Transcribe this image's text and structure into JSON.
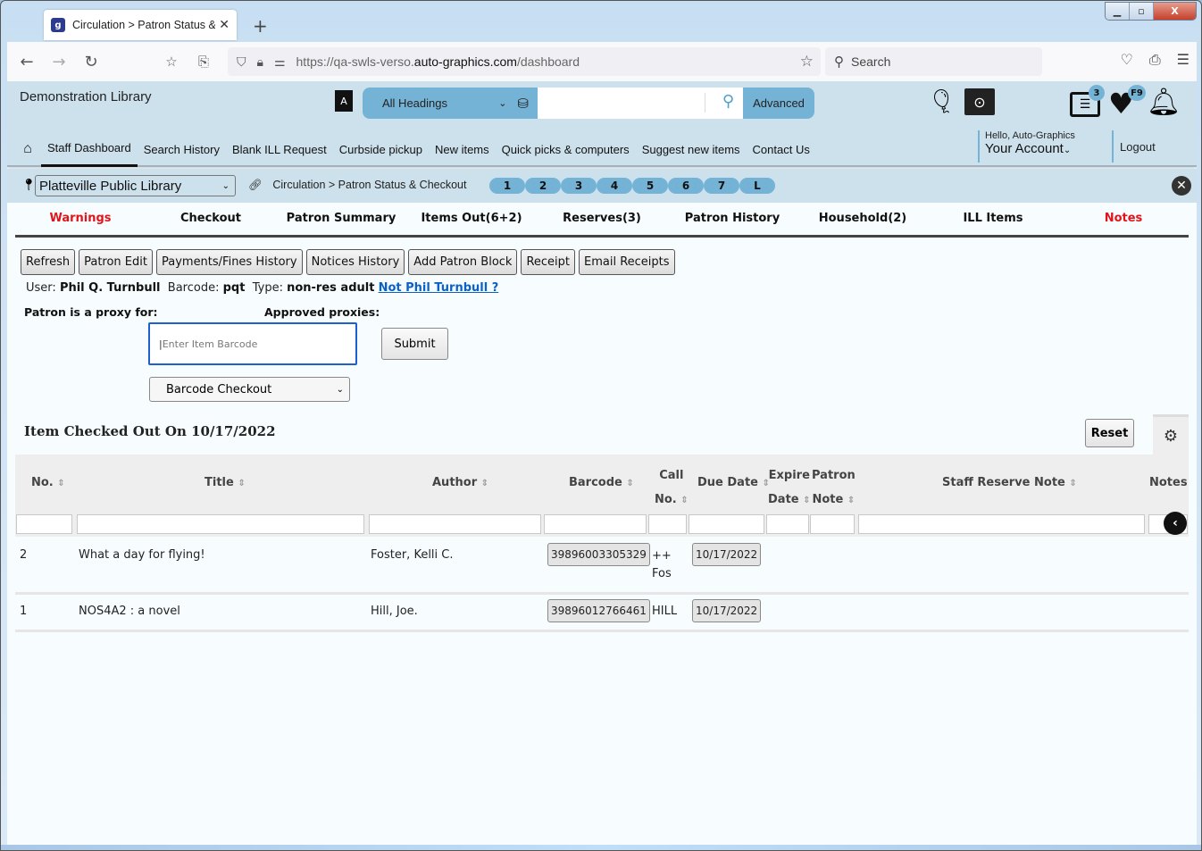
{
  "browser": {
    "tab_title": "Circulation > Patron Status & C",
    "tab_favicon": "g",
    "url_prefix": "https://qa-swls-verso.",
    "url_domain": "auto-graphics.com",
    "url_path": "/dashboard",
    "search_placeholder": "Search",
    "window_controls": {
      "minimize": "—",
      "maximize": "▫",
      "close": "X"
    }
  },
  "header": {
    "library_name": "Demonstration Library",
    "search_scope": "All Headings",
    "search_value": "",
    "advanced_label": "Advanced",
    "cart_badge": "3",
    "favorites_badge": "F9",
    "greeting": "Hello, Auto-Graphics",
    "account_label": "Your Account",
    "logout_label": "Logout"
  },
  "menu": {
    "items": [
      {
        "label": "Staff Dashboard",
        "active": true
      },
      {
        "label": "Search History"
      },
      {
        "label": "Blank ILL Request"
      },
      {
        "label": "Curbside pickup"
      },
      {
        "label": "New items"
      },
      {
        "label": "Quick picks & computers"
      },
      {
        "label": "Suggest new items"
      },
      {
        "label": "Contact Us"
      }
    ]
  },
  "location": {
    "library": "Platteville Public Library",
    "breadcrumb": "Circulation > Patron Status & Checkout",
    "quick_pills": [
      "1",
      "2",
      "3",
      "4",
      "5",
      "6",
      "7",
      "L"
    ]
  },
  "patron_tabs": [
    {
      "label": "Warnings",
      "color": "#e0141a"
    },
    {
      "label": "Checkout"
    },
    {
      "label": "Patron Summary"
    },
    {
      "label": "Items Out(6+2)"
    },
    {
      "label": "Reserves(3)"
    },
    {
      "label": "Patron History"
    },
    {
      "label": "Household(2)"
    },
    {
      "label": "ILL Items"
    },
    {
      "label": "Notes",
      "color": "#e0141a"
    }
  ],
  "actions": [
    "Refresh",
    "Patron Edit",
    "Payments/Fines History",
    "Notices History",
    "Add Patron Block",
    "Receipt",
    "Email Receipts"
  ],
  "patron": {
    "user_label": "User:",
    "user_name": "Phil Q. Turnbull",
    "barcode_label": "Barcode:",
    "barcode": "pqt",
    "type_label": "Type:",
    "type": "non-res adult",
    "not_link": "Not Phil Turnbull ?",
    "proxy_for_label": "Patron is a proxy for:",
    "approved_proxies_label": "Approved proxies:"
  },
  "checkout": {
    "barcode_placeholder": "Enter Item Barcode",
    "submit_label": "Submit",
    "mode": "Barcode Checkout"
  },
  "table": {
    "title": "Item Checked Out On 10/17/2022",
    "reset_label": "Reset",
    "columns": [
      {
        "l1": "",
        "l2": "No."
      },
      {
        "l1": "",
        "l2": "Title"
      },
      {
        "l1": "",
        "l2": "Author"
      },
      {
        "l1": "",
        "l2": "Barcode"
      },
      {
        "l1": "Call",
        "l2": "No."
      },
      {
        "l1": "",
        "l2": "Due Date"
      },
      {
        "l1": "Expire",
        "l2": "Date"
      },
      {
        "l1": "Patron",
        "l2": "Note"
      },
      {
        "l1": "",
        "l2": "Staff Reserve Note"
      },
      {
        "l1": "",
        "l2": "Notes"
      }
    ],
    "rows": [
      {
        "no": "2",
        "title": "What a day for flying!",
        "author": "Foster, Kelli C.",
        "barcode": "39896003305329",
        "call_no_1": "++",
        "call_no_2": "Fos",
        "due_date": "10/17/2022"
      },
      {
        "no": "1",
        "title": "NOS4A2 : a novel",
        "author": "Hill, Joe.",
        "barcode": "39896012766461",
        "call_no_1": "HILL",
        "call_no_2": "",
        "due_date": "10/17/2022"
      }
    ]
  }
}
